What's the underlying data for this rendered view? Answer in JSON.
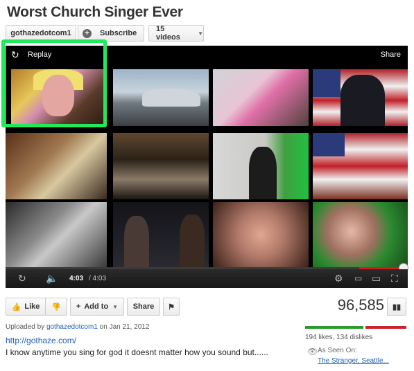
{
  "video": {
    "title": "Worst Church Singer Ever",
    "current_time": "4:03",
    "total_time": "/ 4:03",
    "progress": 1.0
  },
  "channel": {
    "name": "gothazedotcom1",
    "subscribe_label": "Subscribe",
    "videos_label": "15 videos"
  },
  "endscreen": {
    "replay_label": "Replay",
    "share_label": "Share"
  },
  "actions": {
    "like_label": "Like",
    "add_to_label": "Add to",
    "share_label": "Share",
    "views": "96,585"
  },
  "info": {
    "uploaded_prefix": "Uploaded by",
    "uploader": "gothazedotcom1",
    "uploaded_on": "on Jan 21, 2012",
    "link": "http://gothaze.com/",
    "description": "I know anytime you sing for god it doesnt matter how you sound but......",
    "likes_dislikes": "194 likes, 134 dislikes",
    "like_fraction": 0.59,
    "as_seen_on_label": "As Seen On:",
    "as_seen_on_links": "The Stranger, Seattle..."
  },
  "colors": {
    "highlight": "#23e85a",
    "progress": "#d01c1c",
    "like_bar_green": "#2a9a2a",
    "like_bar_red": "#c8222a",
    "link_blue": "#1c62b9"
  }
}
